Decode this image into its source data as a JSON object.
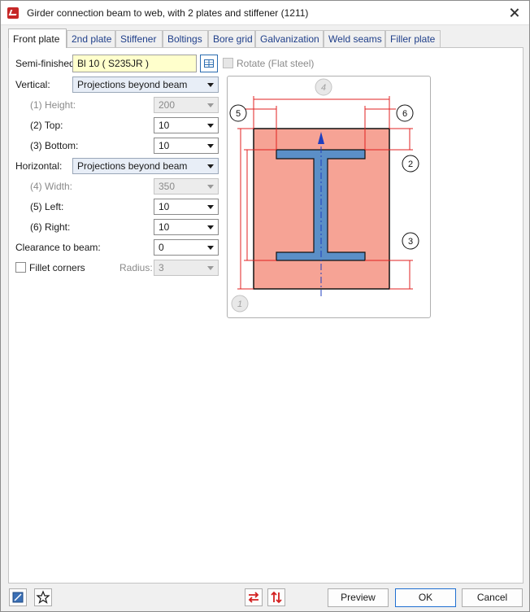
{
  "window": {
    "title": "Girder connection beam to web, with 2 plates and stiffener (1211)"
  },
  "tabs": [
    {
      "label": "Front plate",
      "active": true
    },
    {
      "label": "2nd plate"
    },
    {
      "label": "Stiffener"
    },
    {
      "label": "Boltings"
    },
    {
      "label": "Bore grid"
    },
    {
      "label": "Galvanization"
    },
    {
      "label": "Weld seams"
    },
    {
      "label": "Filler plate"
    }
  ],
  "form": {
    "semifinished_label": "Semi-finished",
    "semifinished_value": "Bl 10  ( S235JR )",
    "rotate_label": "Rotate (Flat steel)",
    "vertical_label": "Vertical:",
    "vertical_value": "Projections beyond beam",
    "height_label": "(1) Height:",
    "height_value": "200",
    "top_label": "(2) Top:",
    "top_value": "10",
    "bottom_label": "(3) Bottom:",
    "bottom_value": "10",
    "horizontal_label": "Horizontal:",
    "horizontal_value": "Projections beyond beam",
    "width_label": "(4) Width:",
    "width_value": "350",
    "left_label": "(5) Left:",
    "left_value": "10",
    "right_label": "(6) Right:",
    "right_value": "10",
    "clearance_label": "Clearance to beam:",
    "clearance_value": "0",
    "fillet_label": "Fillet corners",
    "radius_label": "Radius:",
    "radius_value": "3"
  },
  "diagram": {
    "markers": [
      "1",
      "2",
      "3",
      "4",
      "5",
      "6"
    ],
    "colors": {
      "plate": "#f6a395",
      "beam": "#5b8fc7",
      "dim": "#e02020",
      "axis": "#1f3fbf"
    }
  },
  "footer": {
    "preview_label": "Preview",
    "ok_label": "OK",
    "cancel_label": "Cancel"
  }
}
